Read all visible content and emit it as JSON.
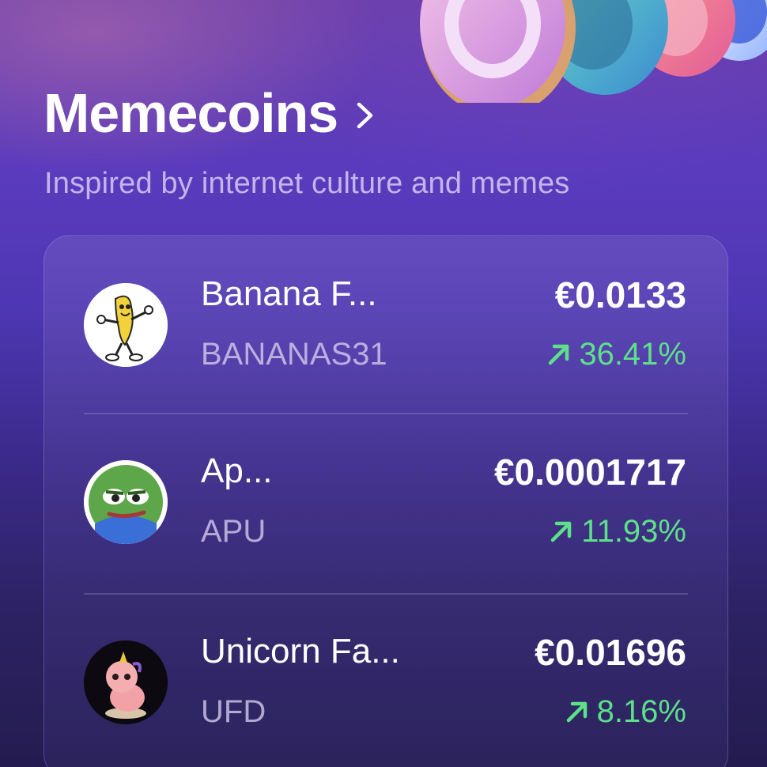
{
  "section": {
    "title": "Memecoins",
    "subtitle": "Inspired by internet culture and memes"
  },
  "coins": [
    {
      "name": "Banana F...",
      "ticker": "BANANAS31",
      "price": "€0.0133",
      "change": "36.41%",
      "avatar": "banana-mascot-icon"
    },
    {
      "name": "Ap...",
      "ticker": "APU",
      "price": "€0.0001717",
      "change": "11.93%",
      "avatar": "frog-apu-icon"
    },
    {
      "name": "Unicorn Fa...",
      "ticker": "UFD",
      "price": "€0.01696",
      "change": "8.16%",
      "avatar": "pink-unicorn-icon"
    }
  ],
  "colors": {
    "positive": "#5ee08a",
    "background": "#4e37b3"
  }
}
